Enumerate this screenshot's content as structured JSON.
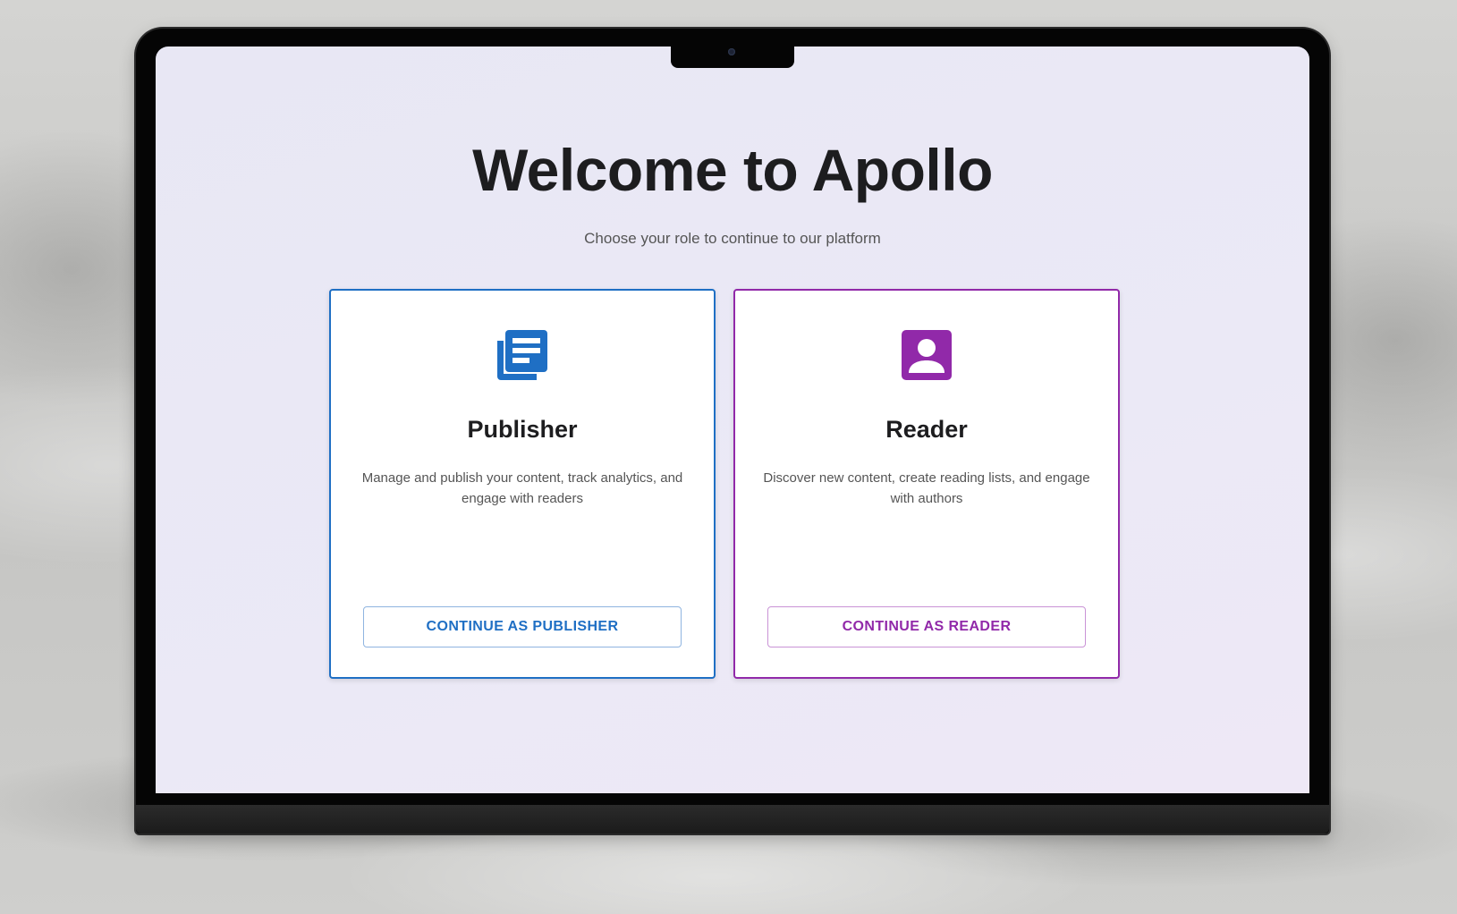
{
  "page": {
    "title": "Welcome to Apollo",
    "subtitle": "Choose your role to continue to our platform"
  },
  "roles": [
    {
      "title": "Publisher",
      "description": "Manage and publish your content, track analytics, and engage with readers",
      "button_label": "CONTINUE AS PUBLISHER",
      "icon": "newspaper-icon",
      "accent_color": "#1f6fc4"
    },
    {
      "title": "Reader",
      "description": "Discover new content, create reading lists, and engage with authors",
      "button_label": "CONTINUE AS READER",
      "icon": "account-box-icon",
      "accent_color": "#9129a9"
    }
  ],
  "colors": {
    "screen_background": "#ebe9f6",
    "title_text": "#1d1d1f",
    "body_text": "#555555"
  }
}
